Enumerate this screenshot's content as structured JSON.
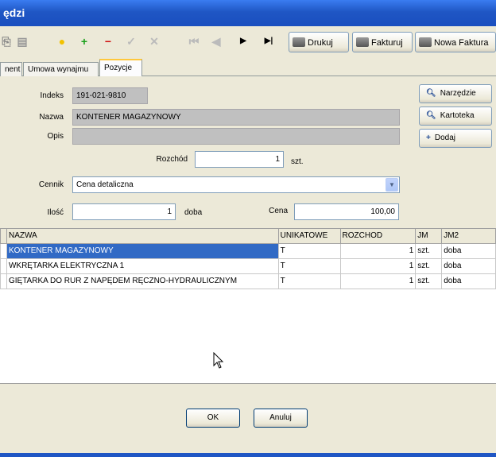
{
  "window": {
    "title": "ędzi"
  },
  "toolbar": {
    "print_label": "Drukuj",
    "invoice_label": "Fakturuj",
    "new_invoice_label": "Nowa Faktura"
  },
  "tabs": [
    {
      "label": "nent"
    },
    {
      "label": "Umowa wynajmu"
    },
    {
      "label": "Pozycje"
    }
  ],
  "form": {
    "index_label": "Indeks",
    "index_value": "191-021-9810",
    "name_label": "Nazwa",
    "name_value": "KONTENER MAGAZYNOWY",
    "desc_label": "Opis",
    "desc_value": "",
    "issue_label": "Rozchód",
    "issue_value": "1",
    "issue_unit": "szt.",
    "pricelist_label": "Cennik",
    "pricelist_value": "Cena detaliczna",
    "qty_label": "Ilość",
    "qty_value": "1",
    "qty_unit": "doba",
    "price_label": "Cena",
    "price_value": "100,00"
  },
  "side_buttons": {
    "tool_label": "Narzędzie",
    "card_label": "Kartoteka",
    "add_label": "Dodaj"
  },
  "grid": {
    "columns": [
      "NAZWA",
      "UNIKATOWE",
      "ROZCHOD",
      "JM",
      "JM2"
    ],
    "rows": [
      [
        "KONTENER MAGAZYNOWY",
        "T",
        "1",
        "szt.",
        "doba"
      ],
      [
        "WKRĘTARKA ELEKTRYCZNA 1",
        "T",
        "1",
        "szt.",
        "doba"
      ],
      [
        "GIĘTARKA DO RUR Z NAPĘDEM RĘCZNO-HYDRAULICZNYM",
        "T",
        "1",
        "szt.",
        "doba"
      ]
    ]
  },
  "dialog": {
    "ok_label": "OK",
    "cancel_label": "Anuluj"
  }
}
